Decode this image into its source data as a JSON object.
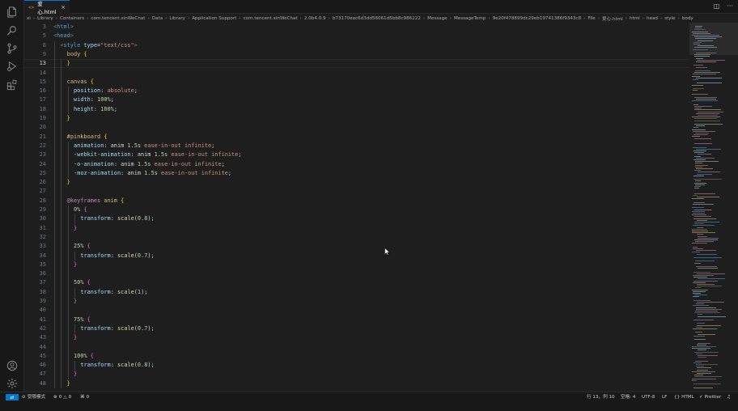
{
  "tab": {
    "icon": "<>",
    "label": "爱心.html",
    "close": "×"
  },
  "tab_actions": {
    "split": "◫",
    "more": "···"
  },
  "breadcrumb": [
    "xi",
    "Library",
    "Containers",
    "com.tencent.xinWeChat",
    "Data",
    "Library",
    "Application Support",
    "com.tencent.xinWeChat",
    "2.0b4.0.9",
    "b73170eac6d3dd56061d5bb8c986222",
    "Message",
    "MessageTemp",
    "9e20f478899dc29eb19741386f9343c8",
    "File",
    "爱心.html",
    "html",
    "head",
    "style",
    "body"
  ],
  "editor": {
    "line_numbers": [
      "3",
      "5",
      "8",
      "9",
      "13",
      "14",
      "15",
      "16",
      "17",
      "18",
      "19",
      "20",
      "21",
      "22",
      "23",
      "24",
      "25",
      "26",
      "27",
      "28",
      "29",
      "30",
      "31",
      "32",
      "33",
      "34",
      "35",
      "36",
      "37",
      "38",
      "39",
      "40",
      "41",
      "42",
      "43",
      "44",
      "45",
      "46",
      "47",
      "48"
    ],
    "active_line": "13"
  },
  "status": {
    "remote_icon": "⇄",
    "mode": "受限模式",
    "errors": "0",
    "warnings": "0",
    "ports": "0",
    "position": "行 13，列 10",
    "spaces": "空格: 4",
    "encoding": "UTF-8",
    "eol": "LF",
    "language": "HTML",
    "formatter": "Prettier"
  },
  "colors": {
    "accent": "#0078d4",
    "tag": "#569cd6",
    "string": "#ce9178",
    "selector": "#d7ba7d",
    "property": "#9cdcfe",
    "number": "#b5cea8",
    "function": "#dcdcaa",
    "at_rule": "#c586c0",
    "brace": "#ffd700"
  }
}
